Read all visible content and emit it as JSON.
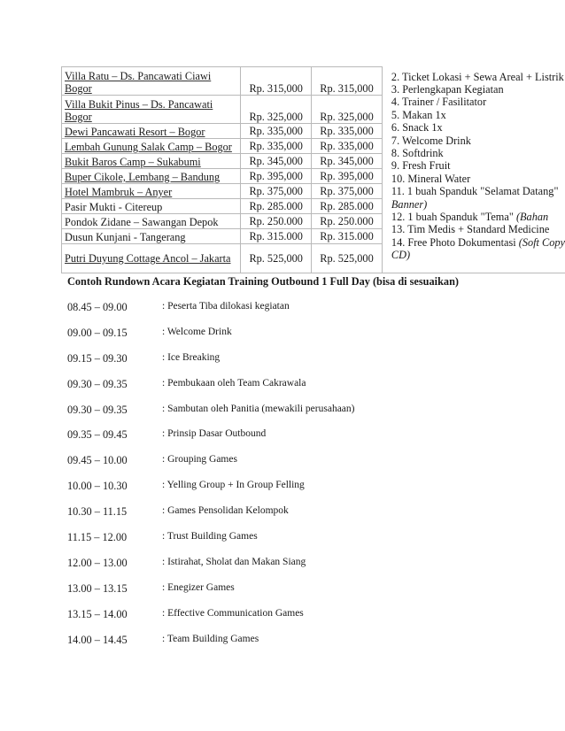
{
  "venues": [
    {
      "name_line1": "Villa  Ratu – Ds. Pancawati  Ciawi",
      "name_line2": "Bogor",
      "price_a": "Rp. 315,000",
      "price_b": "Rp. 315,000"
    },
    {
      "name_line1": "Villa  Bukit  Pinus  – Ds. Pancawati",
      "name_line2": "Bogor",
      "price_a": "Rp. 325,000",
      "price_b": "Rp. 325,000"
    },
    {
      "name_line1": "Dewi  Pancawati  Resort  – Bogor",
      "price_a": "Rp. 335,000",
      "price_b": "Rp. 335,000"
    },
    {
      "name_line1": "Lembah Gunung  Salak Camp  – Bogor",
      "price_a": "Rp. 335,000",
      "price_b": "Rp. 335,000"
    },
    {
      "name_line1": "Bukit  Baros  Camp – Sukabumi",
      "price_a": "Rp. 345,000",
      "price_b": "Rp. 345,000"
    },
    {
      "name_line1": "Buper Cikole, Lembang  – Bandung",
      "price_a": "Rp. 395,000",
      "price_b": "Rp. 395,000"
    },
    {
      "name_line1": "Hotel  Mambruk  – Anyer",
      "price_a": "Rp. 375,000",
      "price_b": "Rp. 375,000"
    },
    {
      "name_line1": "Pasir  Mukti  - Citereup",
      "price_a": "Rp. 285.000",
      "price_b": "Rp. 285.000"
    },
    {
      "name_line1": "Pondok  Zidane  – Sawangan  Depok",
      "price_a": "Rp. 250.000",
      "price_b": "Rp. 250.000"
    },
    {
      "name_line1": "Dusun  Kunjani  - Tangerang",
      "price_a": "Rp. 315.000",
      "price_b": "Rp. 315.000"
    },
    {
      "name_line1": "Putri  Duyung  Cottage  Ancol – Jakarta",
      "price_a": "Rp. 525,000",
      "price_b": "Rp. 525,000"
    }
  ],
  "facilities": [
    {
      "text": "2. Ticket  Lokasi + Sewa Areal + Listrik",
      "italic": ""
    },
    {
      "text": "3. Perlengkapan  Kegiatan",
      "italic": ""
    },
    {
      "text": "4. Trainer  / Fasilitator",
      "italic": ""
    },
    {
      "text": "5. Makan 1x",
      "italic": ""
    },
    {
      "text": "6. Snack 1x",
      "italic": ""
    },
    {
      "text": "7. Welcome  Drink",
      "italic": ""
    },
    {
      "text": "8. Softdrink",
      "italic": ""
    },
    {
      "text": "9. Fresh Fruit",
      "italic": ""
    },
    {
      "text": "10. Mineral  Water",
      "italic": ""
    },
    {
      "text": "11. 1 buah  Spanduk  \"Selamat  Datang\"",
      "italic": ""
    },
    {
      "text": "",
      "italic": "Banner)"
    },
    {
      "text": "12. 1 buah  Spanduk  \"Tema\"  ",
      "italic": "(Bahan"
    },
    {
      "text": "13. Tim  Medis  + Standard  Medicine",
      "italic": ""
    },
    {
      "text": "14. Free Photo  Dokumentasi  ",
      "italic": "(Soft Copy"
    },
    {
      "text": "",
      "italic": "CD)"
    }
  ],
  "rundown": {
    "title": "Contoh  Rundown  Acara  Kegiatan Training  Outbound  1 Full Day (bisa  di  sesuaikan)",
    "items": [
      {
        "time": "08.45 – 09.00",
        "activity": ": Peserta  Tiba dilokasi  kegiatan"
      },
      {
        "time": "09.00 – 09.15",
        "activity": ": Welcome  Drink"
      },
      {
        "time": "09.15 – 09.30",
        "activity": ": Ice  Breaking"
      },
      {
        "time": "09.30 – 09.35",
        "activity": ": Pembukaan  oleh  Team Cakrawala"
      },
      {
        "time": "09.30 – 09.35",
        "activity": ": Sambutan  oleh  Panitia  (mewakili  perusahaan)"
      },
      {
        "time": "09.35 – 09.45",
        "activity": ": Prinsip  Dasar Outbound"
      },
      {
        "time": "09.45 – 10.00",
        "activity": ": Grouping  Games"
      },
      {
        "time": "10.00 – 10.30",
        "activity": ": Yelling  Group + In Group Felling"
      },
      {
        "time": "10.30 – 11.15",
        "activity": ": Games  Pensolidan  Kelompok"
      },
      {
        "time": "11.15 – 12.00",
        "activity": ": Trust  Building  Games"
      },
      {
        "time": "12.00 – 13.00",
        "activity": ": Istirahat,  Sholat  dan Makan Siang"
      },
      {
        "time": "13.00 – 13.15",
        "activity": ": Enegizer  Games"
      },
      {
        "time": "13.15 – 14.00",
        "activity": ": Effective  Communication  Games"
      },
      {
        "time": "14.00 – 14.45",
        "activity": ": Team Building  Games"
      }
    ]
  }
}
